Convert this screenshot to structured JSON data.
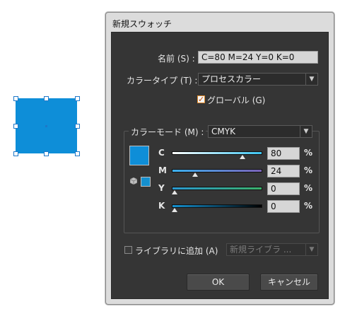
{
  "dialog": {
    "title": "新規スウォッチ",
    "name_label": "名前 (S) :",
    "name_value": "C=80 M=24 Y=0 K=0",
    "color_type_label": "カラータイプ (T) :",
    "color_type_value": "プロセスカラー",
    "global_label": "グローバル (G)",
    "global_checked": true,
    "color_mode_label": "カラーモード (M) :",
    "color_mode_value": "CMYK",
    "channels": [
      {
        "label": "C",
        "value": "80",
        "unit": "%",
        "fraction": 0.8
      },
      {
        "label": "M",
        "value": "24",
        "unit": "%",
        "fraction": 0.24
      },
      {
        "label": "Y",
        "value": "0",
        "unit": "%",
        "fraction": 0.0
      },
      {
        "label": "K",
        "value": "0",
        "unit": "%",
        "fraction": 0.0
      }
    ],
    "add_to_library_label": "ライブラリに追加 (A)",
    "add_to_library_checked": false,
    "library_value": "新規ライブラ ...",
    "ok_label": "OK",
    "cancel_label": "キャンセル"
  },
  "colors": {
    "swatch": "#0e8ed8",
    "dialog_bg": "#353535",
    "check_accent": "#e08a2a"
  },
  "icons": {
    "dropdown": "triangle-down-icon",
    "checkmark": "checkmark-icon",
    "slider_thumb": "triangle-up-icon",
    "gamut": "cube-icon"
  }
}
